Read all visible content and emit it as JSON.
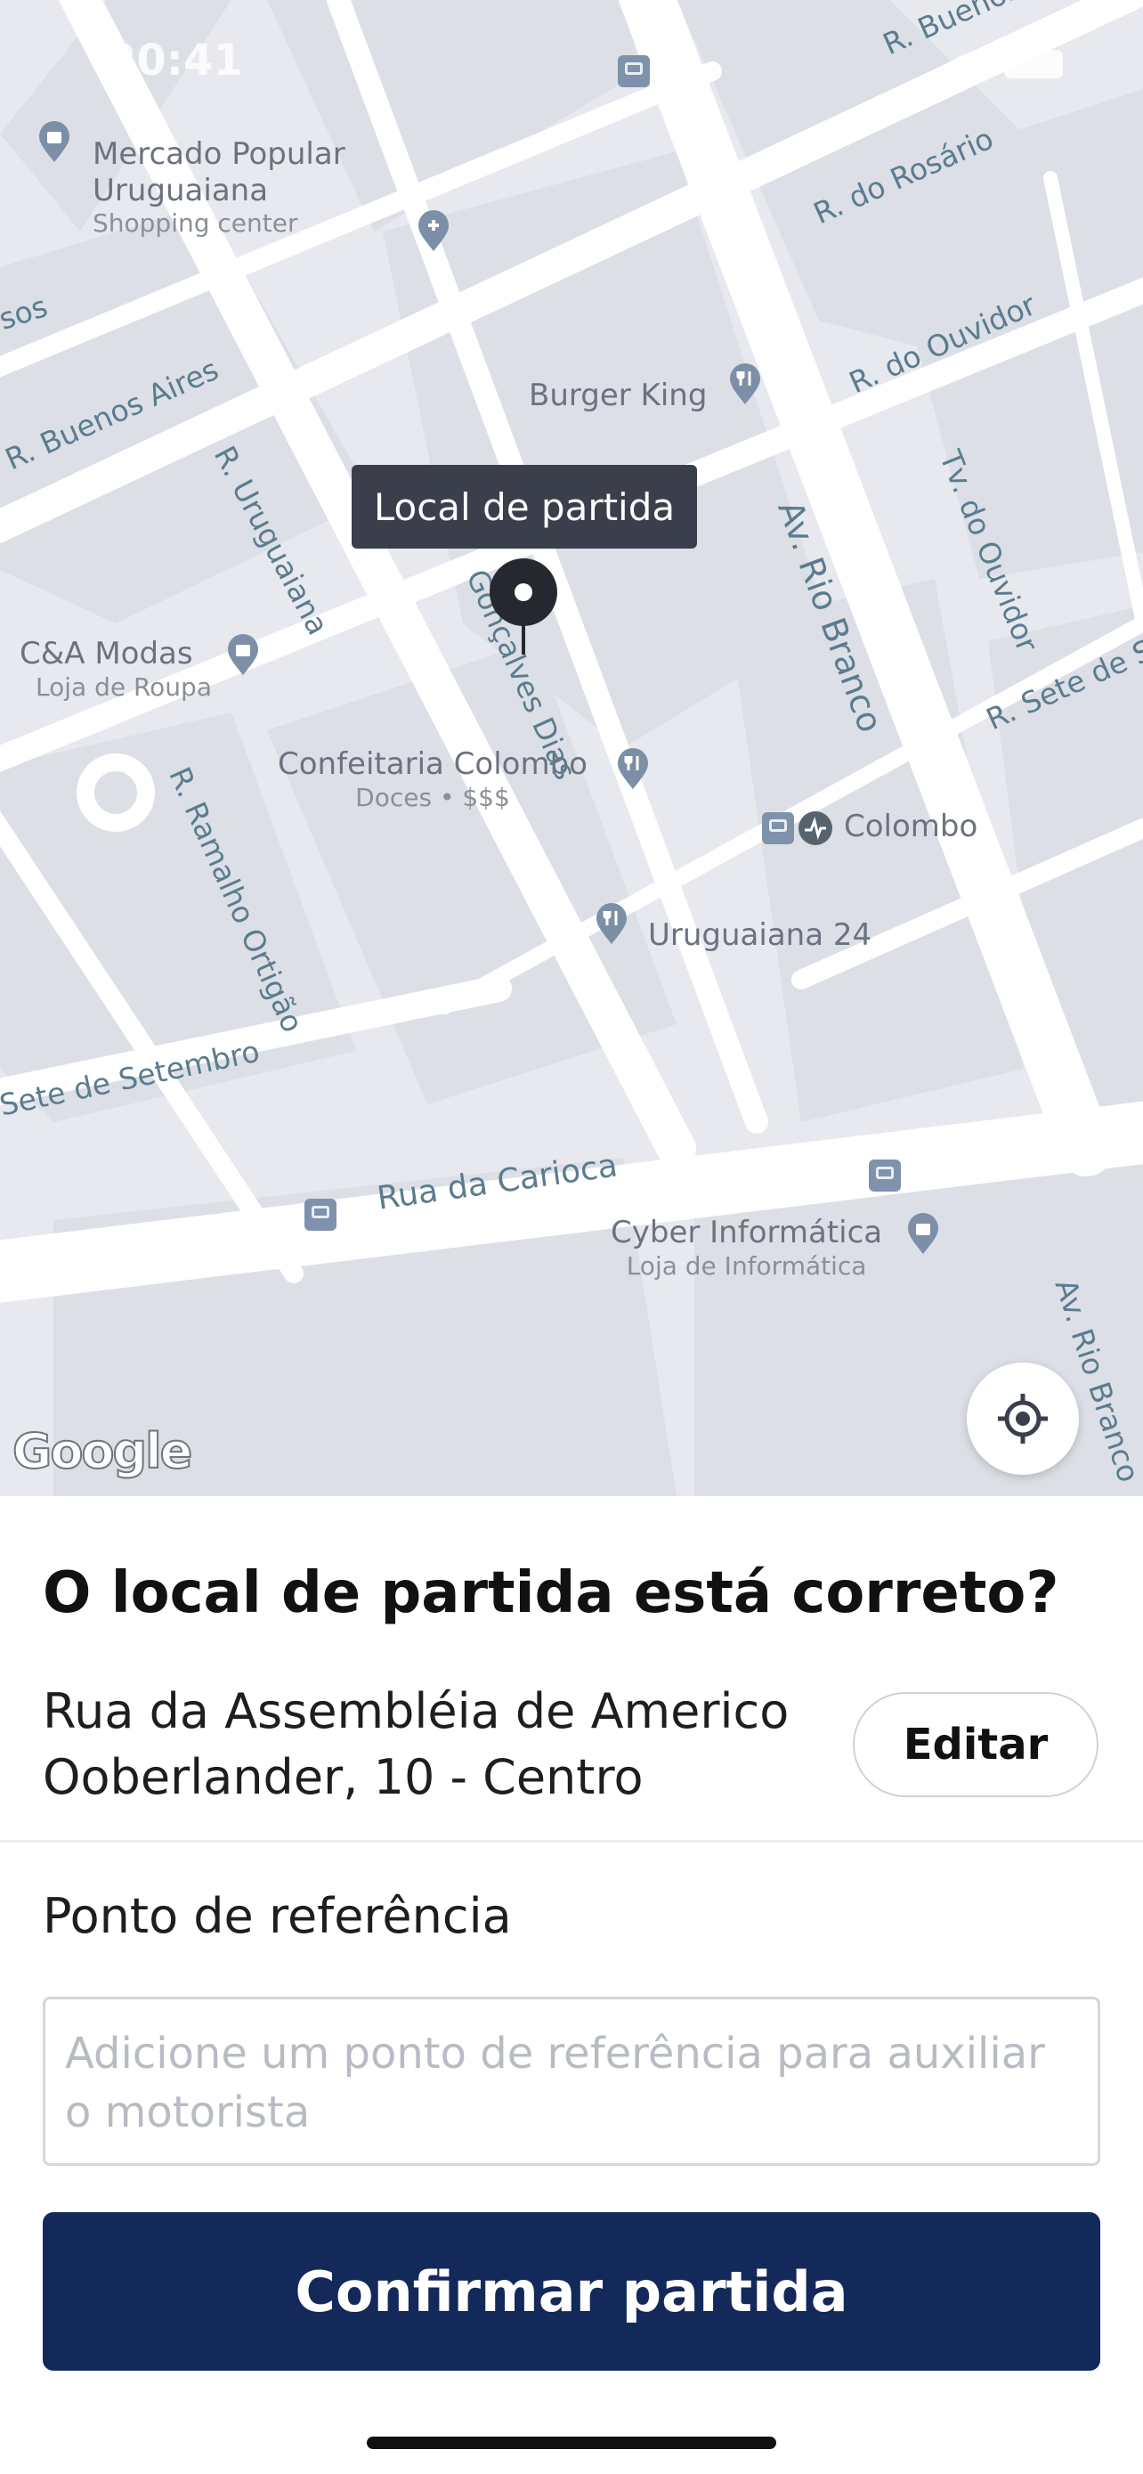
{
  "status_bar": {
    "time": "20:41"
  },
  "map": {
    "tooltip": "Local de partida",
    "attribution": "Google",
    "pois": [
      {
        "name": "Mercado Popular\nUruguaiana",
        "sub": "Shopping center"
      },
      {
        "name": "Burger King",
        "sub": ""
      },
      {
        "name": "C&A Modas",
        "sub": "Loja de Roupa"
      },
      {
        "name": "Confeitaria Colombo",
        "sub": "Doces • $$$"
      },
      {
        "name": "Colombo",
        "sub": ""
      },
      {
        "name": "Uruguaiana 24",
        "sub": ""
      },
      {
        "name": "Cyber Informática",
        "sub": "Loja de Informática"
      }
    ],
    "streets": [
      "R. Buenos",
      "R. do Rosário",
      "R. do Ouvidor",
      "R. Buenos Aires",
      "R. Uruguaiana",
      "Av. Rio Branco",
      "Tv. do Ouvidor",
      "R. Sete de Set",
      "R. Ramalho Ortigão",
      "Sete de Setembro",
      "Rua da Carioca",
      "Av. Rio Branco",
      "Gonçalves Dias",
      "sos"
    ]
  },
  "sheet": {
    "question": "O local de partida está correto?",
    "address": "Rua da Assembléia de Americo Ooberlander, 10 - Centro",
    "edit_label": "Editar",
    "reference_label": "Ponto de referência",
    "reference_placeholder": "Adicione um ponto de referência para auxiliar o motorista",
    "confirm_label": "Confirmar partida"
  },
  "colors": {
    "primary_button": "#13295a",
    "map_background": "#e7e9ee",
    "road": "#ffffff"
  },
  "icons": [
    "locate-icon",
    "pin-marker-icon",
    "restaurant-icon",
    "shopping-bag-icon",
    "bus-stop-icon",
    "metro-icon",
    "hospital-icon"
  ]
}
